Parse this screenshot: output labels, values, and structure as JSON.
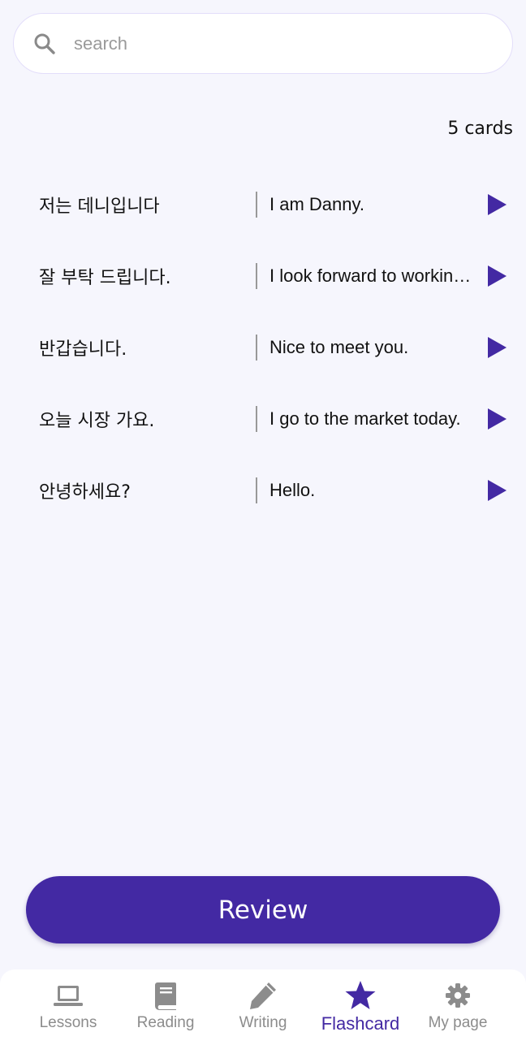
{
  "search": {
    "placeholder": "search",
    "icon": "search-icon"
  },
  "count_label": "5 cards",
  "cards": [
    {
      "front": "저는 데니입니다",
      "back": "I am Danny."
    },
    {
      "front": "잘 부탁 드립니다.",
      "back": "I look forward to working with you."
    },
    {
      "front": "반갑습니다.",
      "back": "Nice to meet you."
    },
    {
      "front": "오늘 시장 가요.",
      "back": "I go to the market today."
    },
    {
      "front": "안녕하세요?",
      "back": "Hello."
    }
  ],
  "review_label": "Review",
  "nav": [
    {
      "label": "Lessons",
      "icon": "laptop-icon"
    },
    {
      "label": "Reading",
      "icon": "book-icon"
    },
    {
      "label": "Writing",
      "icon": "pencil-icon"
    },
    {
      "label": "Flashcard",
      "icon": "star-icon",
      "active": true
    },
    {
      "label": "My page",
      "icon": "gear-icon"
    }
  ],
  "colors": {
    "accent": "#4329a3",
    "background": "#f6f6fd",
    "inactive": "#8c8c8c"
  }
}
